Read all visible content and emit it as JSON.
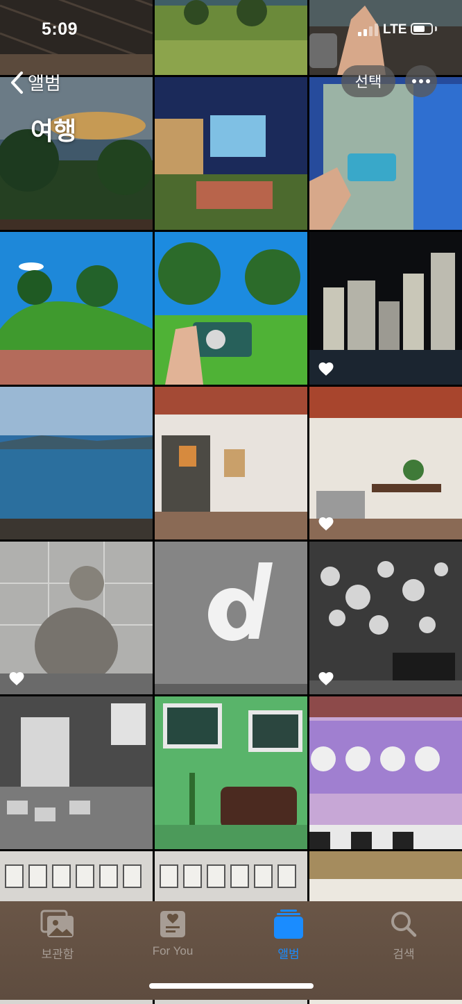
{
  "status_bar": {
    "time": "5:09",
    "network": "LTE"
  },
  "nav": {
    "back_label": "앨범",
    "title": "여행",
    "select_label": "선택",
    "more": "more-icon"
  },
  "tabs": [
    {
      "label": "보관함",
      "icon": "photo-library-icon",
      "active": false
    },
    {
      "label": "For You",
      "icon": "for-you-icon",
      "active": false
    },
    {
      "label": "앨범",
      "icon": "albums-icon",
      "active": true
    },
    {
      "label": "검색",
      "icon": "search-icon",
      "active": false
    }
  ],
  "colors": {
    "accent": "#1a8cff",
    "tab_bar": "#65513f",
    "inactive_tab": "#a79d95"
  },
  "photos": [
    {
      "subject": "dark wooden roof",
      "favorite": false
    },
    {
      "subject": "grassy seaside hill",
      "favorite": false
    },
    {
      "subject": "hand peace sign on rocks",
      "favorite": false
    },
    {
      "subject": "pine trees at sunset",
      "favorite": false
    },
    {
      "subject": "projector screen yard at night",
      "favorite": false
    },
    {
      "subject": "camera vending machine",
      "favorite": false
    },
    {
      "subject": "green hill with trees",
      "favorite": false
    },
    {
      "subject": "film camera in park",
      "favorite": false
    },
    {
      "subject": "city skyline at night",
      "favorite": true
    },
    {
      "subject": "sea view",
      "favorite": false
    },
    {
      "subject": "cafe interior with dried flowers",
      "favorite": false
    },
    {
      "subject": "cafe dining room",
      "favorite": true
    },
    {
      "subject": "stone statue",
      "favorite": true
    },
    {
      "subject": "letter d on wall",
      "favorite": false
    },
    {
      "subject": "clock wall",
      "favorite": true
    },
    {
      "subject": "black and white shop",
      "favorite": false
    },
    {
      "subject": "green room with sofa",
      "favorite": false
    },
    {
      "subject": "purple laundromat",
      "favorite": false
    },
    {
      "subject": "framed botanical prints",
      "favorite": false
    },
    {
      "subject": "framed botanical prints",
      "favorite": false
    },
    {
      "subject": "thatched roof",
      "favorite": false
    }
  ]
}
